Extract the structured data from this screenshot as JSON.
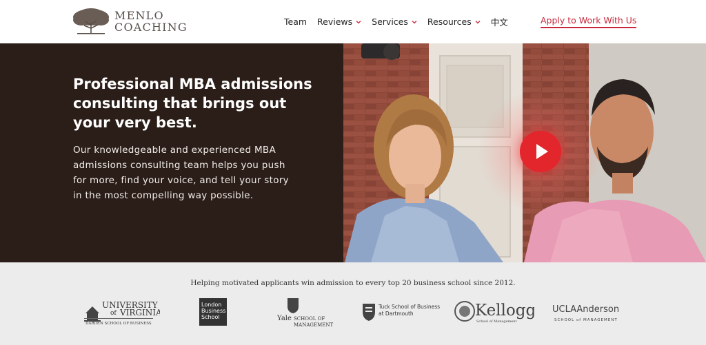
{
  "brand": {
    "line1": "MENLO",
    "line2": "COACHING"
  },
  "nav": {
    "items": [
      {
        "label": "Team",
        "dropdown": false
      },
      {
        "label": "Reviews",
        "dropdown": true
      },
      {
        "label": "Services",
        "dropdown": true
      },
      {
        "label": "Resources",
        "dropdown": true
      },
      {
        "label": "中文",
        "dropdown": false
      }
    ],
    "cta_label": "Apply to Work With Us"
  },
  "hero": {
    "title": "Professional MBA admissions consulting that brings out your very best.",
    "body": "Our knowledgeable and experienced MBA admissions consulting team helps you push for more, find your voice, and tell your story in the most compelling way possible.",
    "play_icon": "play-icon"
  },
  "schools": {
    "tagline": "Helping motivated applicants win admission to every top 20 business school since 2012.",
    "uva": {
      "l1": "UNIVERSITY",
      "of": "of",
      "l2": "VIRGINIA",
      "l3": "DARDEN SCHOOL OF BUSINESS"
    },
    "lbs": {
      "l1": "London",
      "l2": "Business",
      "l3": "School"
    },
    "yale": {
      "l1": "Yale",
      "l2": "SCHOOL OF",
      "l3": "MANAGEMENT"
    },
    "tuck": {
      "l1": "Tuck School of Business",
      "l2": "at Dartmouth"
    },
    "kellogg": {
      "l1": "Kellogg",
      "l2": "School of Management"
    },
    "ucla": {
      "l1": "UCLAAnderson",
      "l2": "SCHOOL of MANAGEMENT"
    }
  },
  "colors": {
    "accent": "#c7283a",
    "hero_bg": "#2b1e18",
    "play": "#e3252c",
    "strip": "#ececec"
  }
}
